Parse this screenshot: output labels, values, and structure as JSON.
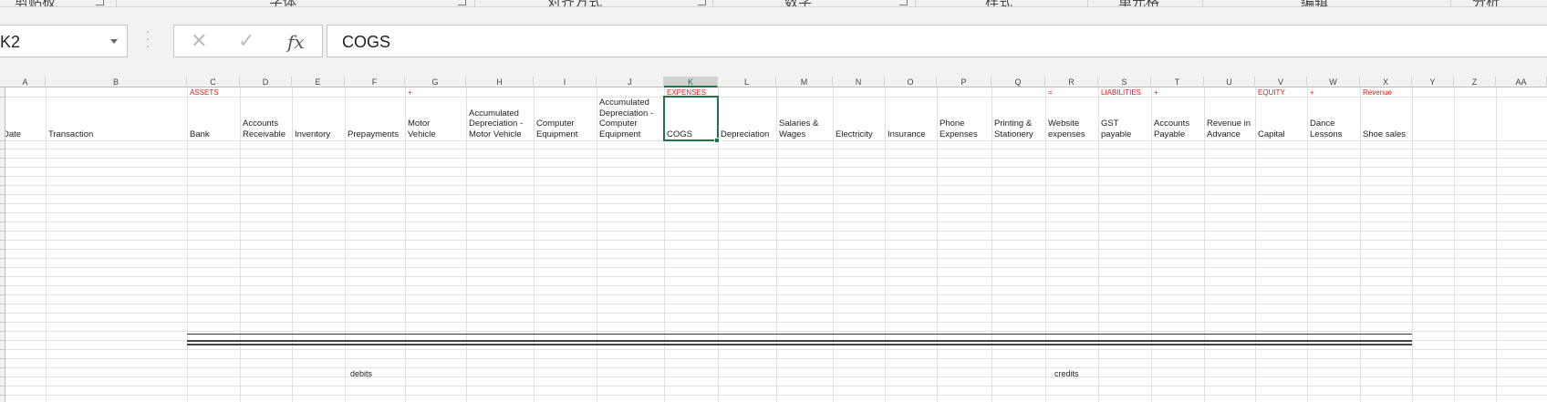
{
  "ribbon": {
    "groups": [
      "剪贴板",
      "字体",
      "对齐方式",
      "数字",
      "样式",
      "单元格",
      "编辑",
      "分析"
    ]
  },
  "formula_bar": {
    "name_box": "K2",
    "cancel_icon": "close-icon",
    "enter_icon": "check-icon",
    "function_icon": "fx",
    "content": "COGS"
  },
  "columns": [
    "A",
    "B",
    "C",
    "D",
    "E",
    "F",
    "G",
    "H",
    "I",
    "J",
    "K",
    "L",
    "M",
    "N",
    "O",
    "P",
    "Q",
    "R",
    "S",
    "T",
    "U",
    "V",
    "W",
    "X",
    "Y",
    "Z",
    "AA"
  ],
  "selected_column": "K",
  "section_labels": {
    "assets": "ASSETS",
    "plus1": "+",
    "expenses": "EXPENSES",
    "equals": "=",
    "liabilities": "LIABILITIES",
    "plus2": "+",
    "equity": "EQUITY",
    "plus3": "+",
    "revenue": "Revenue"
  },
  "headers": {
    "A": "Date",
    "B": "Transaction",
    "C": "Bank",
    "D": "Accounts\nReceivable",
    "E": "Inventory",
    "F": "Prepayments",
    "G": "Motor\nVehicle",
    "H": "Accumulated\nDepreciation -\nMotor Vehicle",
    "I": "Computer\nEquipment",
    "J": "Accumulated\nDepreciation -\nComputer\nEquipment",
    "K": "COGS",
    "L": "Depreciation",
    "M": "Salaries &\nWages",
    "N": "Electricity",
    "O": "Insurance",
    "P": "Phone\nExpenses",
    "Q": "Printing &\nStationery",
    "R": "Website\nexpenses",
    "S": "GST\npayable",
    "T": "Accounts\nPayable",
    "U": "Revenue in\nAdvance",
    "V": "Capital",
    "W": "Dance\nLessons",
    "X": "Shoe sales"
  },
  "totals_labels": {
    "debits": "debits",
    "credits": "credits"
  }
}
